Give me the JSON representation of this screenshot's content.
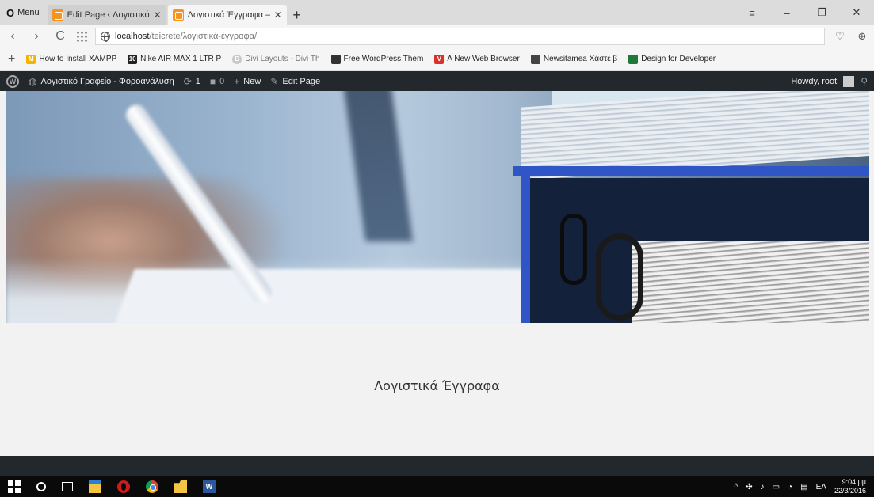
{
  "browser": {
    "menu_label": "Menu",
    "tabs": [
      {
        "label": "Edit Page ‹ Λογιστικό Γραφ",
        "close": "✕"
      },
      {
        "label": "Λογιστικά Έγγραφα – Λογ",
        "close": "✕"
      }
    ],
    "new_tab": "+",
    "window_controls": {
      "tabs_menu": "≡",
      "minimize": "–",
      "maximize": "❐",
      "close": "✕"
    }
  },
  "address_bar": {
    "url_host": "localhost",
    "url_path": "/teicrete/λογιστικά-έγγραφα/",
    "back": "‹",
    "forward": "›",
    "reload": "C",
    "heart": "♡",
    "download": "⊕"
  },
  "bookmarks": {
    "add": "+",
    "items": [
      {
        "label": "How to Install XAMPP",
        "icon_color": "#f5b400",
        "icon_text": "M"
      },
      {
        "label": "Nike AIR MAX 1 LTR P",
        "icon_color": "#222222",
        "icon_text": "10"
      },
      {
        "label": "Divi Layouts - Divi Th",
        "icon_color": "#c8c8c8",
        "icon_text": "D"
      },
      {
        "label": "Free WordPress Them",
        "icon_color": "#333333",
        "icon_text": ""
      },
      {
        "label": "A New Web Browser",
        "icon_color": "#d8322c",
        "icon_text": "V"
      },
      {
        "label": "Newsitamea Χάστε β",
        "icon_color": "#444444",
        "icon_text": ""
      },
      {
        "label": "Design for Developer",
        "icon_color": "#1f7a3a",
        "icon_text": ""
      }
    ]
  },
  "admin_bar": {
    "site_name": "Λογιστικό Γραφείο - Φοροανάλυση",
    "updates_count": "1",
    "comments_count": "0",
    "new_label": "New",
    "edit_label": "Edit Page",
    "howdy": "Howdy, root"
  },
  "page": {
    "title": "Λογιστικά Έγγραφα"
  },
  "taskbar": {
    "lang": "ΕΛ",
    "time": "9:04 μμ",
    "date": "22/3/2016"
  }
}
